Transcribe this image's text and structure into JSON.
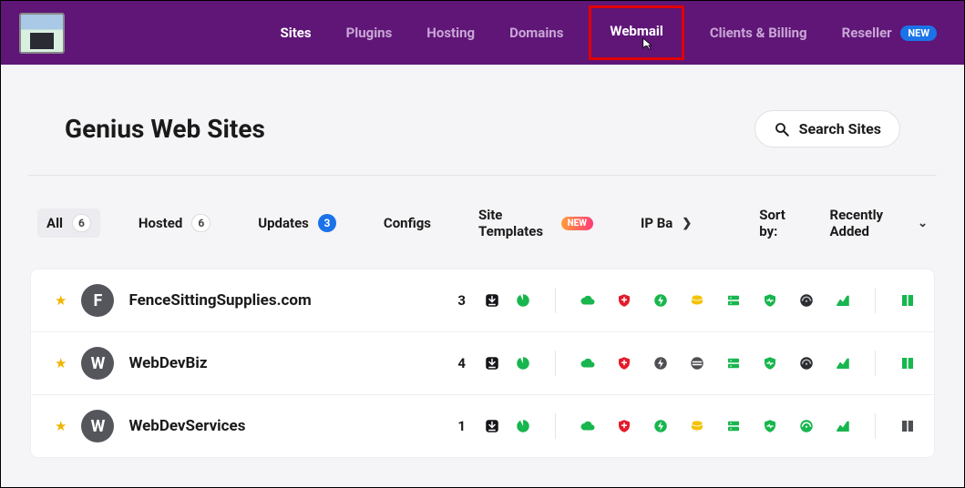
{
  "header": {
    "nav": {
      "sites": "Sites",
      "plugins": "Plugins",
      "hosting": "Hosting",
      "domains": "Domains",
      "webmail": "Webmail",
      "clients_billing": "Clients & Billing",
      "reseller": "Reseller",
      "new_badge": "NEW"
    }
  },
  "page": {
    "title": "Genius Web Sites",
    "search_label": "Search Sites"
  },
  "filters": {
    "all": {
      "label": "All",
      "count": "6"
    },
    "hosted": {
      "label": "Hosted",
      "count": "6"
    },
    "updates": {
      "label": "Updates",
      "count": "3"
    },
    "configs": {
      "label": "Configs"
    },
    "site_templates": {
      "label": "Site Templates",
      "badge": "NEW"
    },
    "ip_banning_truncated": {
      "label": "IP Ba"
    },
    "sort_by_label": "Sort by:",
    "sort_by_value": "Recently Added"
  },
  "sites": [
    {
      "initial": "F",
      "name": "FenceSittingSupplies.com",
      "updates": "3",
      "icons": {
        "speed": "green",
        "shield": "red",
        "bolt": "green",
        "disk": "yellow",
        "server": "green",
        "heart": "green",
        "gauge": "dark",
        "trend": "green",
        "book": "green"
      }
    },
    {
      "initial": "W",
      "name": "WebDevBiz",
      "updates": "4",
      "icons": {
        "speed": "green",
        "shield": "red",
        "bolt": "gray",
        "disk": "gray-striped",
        "server": "green",
        "heart": "green",
        "gauge": "dark",
        "trend": "green",
        "book": "green"
      }
    },
    {
      "initial": "W",
      "name": "WebDevServices",
      "updates": "1",
      "icons": {
        "speed": "green",
        "shield": "red",
        "bolt": "green",
        "disk": "yellow",
        "server": "green",
        "heart": "green",
        "gauge": "green",
        "trend": "green",
        "book": "gray"
      }
    }
  ]
}
